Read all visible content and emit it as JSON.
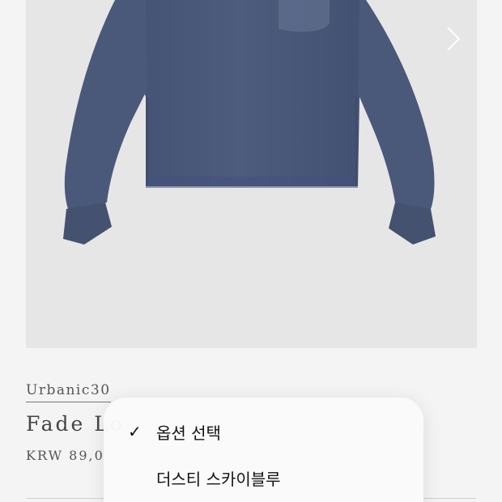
{
  "product": {
    "brand": "Urbanic30",
    "title": "Fade Lo",
    "price": "KRW 89,0",
    "image_alt": "navy long sleeve top with pocket"
  },
  "gallery": {
    "next_icon": "chevron-right-icon"
  },
  "option_menu": {
    "items": [
      {
        "label": "옵션 선택",
        "selected": true
      },
      {
        "label": "더스티 스카이블루",
        "selected": false
      }
    ],
    "check_glyph": "✓"
  },
  "colors": {
    "background": "#f4f4f4",
    "image_bg": "#e6e6e6",
    "garment": "#4a5878"
  }
}
